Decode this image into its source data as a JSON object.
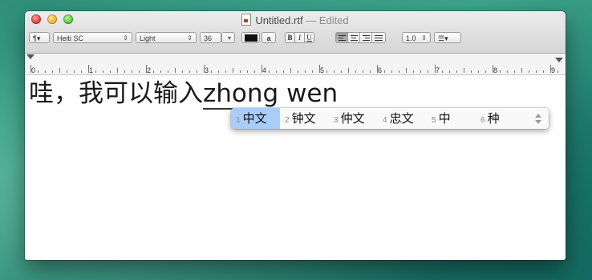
{
  "window": {
    "title": "Untitled.rtf",
    "title_suffix": "— Edited"
  },
  "toolbar": {
    "paragraph_label": "¶▾",
    "font_family": "Heiti SC",
    "font_style": "Light",
    "font_size": "36",
    "text_color": "#111111",
    "highlight_label": "a",
    "bold_label": "B",
    "italic_label": "I",
    "underline_label": "U",
    "line_spacing": "1.0",
    "list_label": "☰▾"
  },
  "ruler": {
    "numbers": [
      "0",
      "1",
      "2",
      "3",
      "4",
      "5",
      "6",
      "7",
      "8",
      "9"
    ]
  },
  "document": {
    "committed_text": "哇，我可以输入",
    "marked_text": "zhong wen"
  },
  "candidates": [
    {
      "index": "1",
      "text": "中文"
    },
    {
      "index": "2",
      "text": "钟文"
    },
    {
      "index": "3",
      "text": "仲文"
    },
    {
      "index": "4",
      "text": "忠文"
    },
    {
      "index": "5",
      "text": "中"
    },
    {
      "index": "6",
      "text": "种"
    }
  ],
  "colors": {
    "selected_candidate": "#a9cdf7",
    "close": "#e0443e",
    "minimize": "#f2b23a",
    "zoom": "#5cc83b"
  }
}
